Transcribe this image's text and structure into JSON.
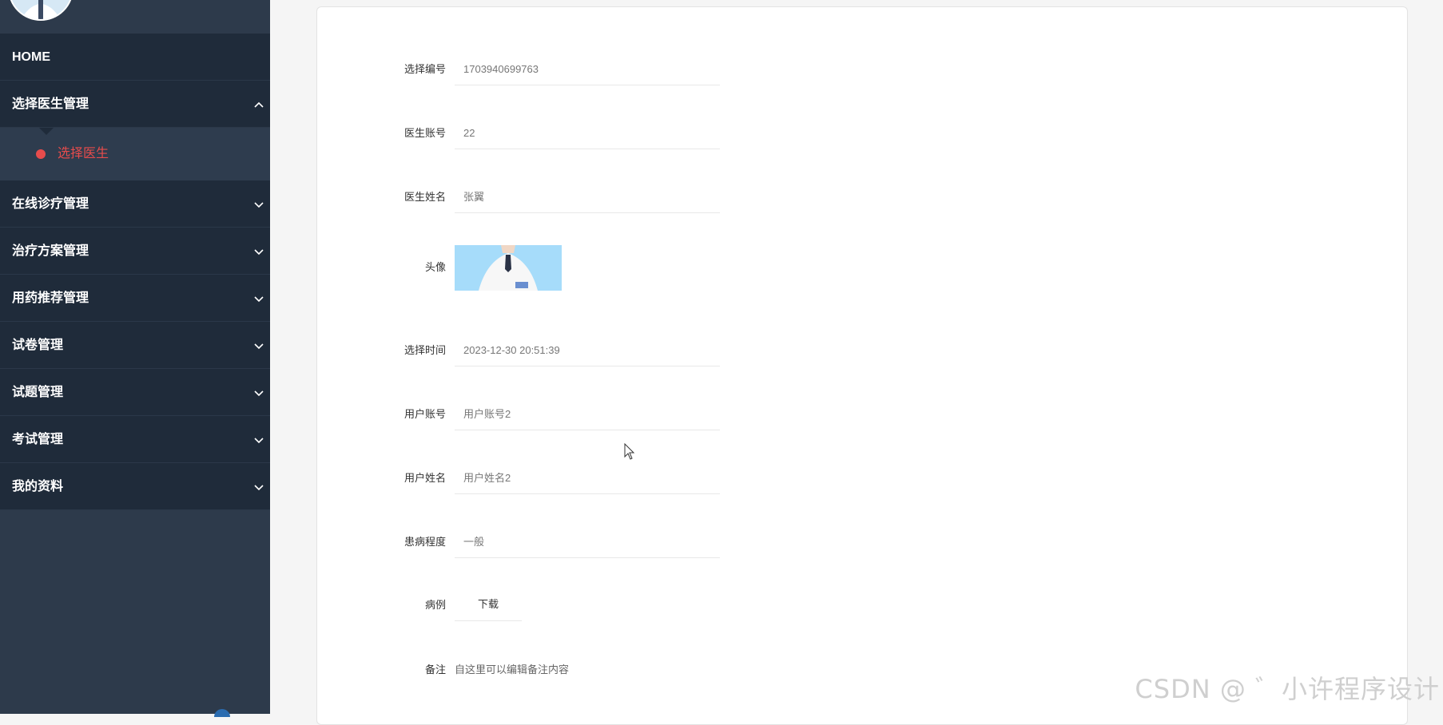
{
  "sidebar": {
    "home_label": "HOME",
    "items": [
      {
        "label": "选择医生管理",
        "expanded": true
      },
      {
        "label": "在线诊疗管理"
      },
      {
        "label": "治疗方案管理"
      },
      {
        "label": "用药推荐管理"
      },
      {
        "label": "试卷管理"
      },
      {
        "label": "试题管理"
      },
      {
        "label": "考试管理"
      },
      {
        "label": "我的资料"
      }
    ],
    "active_sub_item": "选择医生",
    "active_color": "#e74c4c"
  },
  "form": {
    "select_no": {
      "label": "选择编号",
      "value": "1703940699763"
    },
    "doctor_account": {
      "label": "医生账号",
      "value": "22"
    },
    "doctor_name": {
      "label": "医生姓名",
      "value": "张翼"
    },
    "avatar": {
      "label": "头像"
    },
    "select_time": {
      "label": "选择时间",
      "value": "2023-12-30 20:51:39"
    },
    "user_account": {
      "label": "用户账号",
      "value": "用户账号2"
    },
    "user_name": {
      "label": "用户姓名",
      "value": "用户姓名2"
    },
    "severity": {
      "label": "患病程度",
      "value": "一般"
    },
    "case": {
      "label": "病例",
      "button": "下载"
    },
    "remark": {
      "label": "备注",
      "value": "自这里可以编辑备注内容"
    }
  },
  "watermark": "CSDN @ ゛小许程序设计"
}
